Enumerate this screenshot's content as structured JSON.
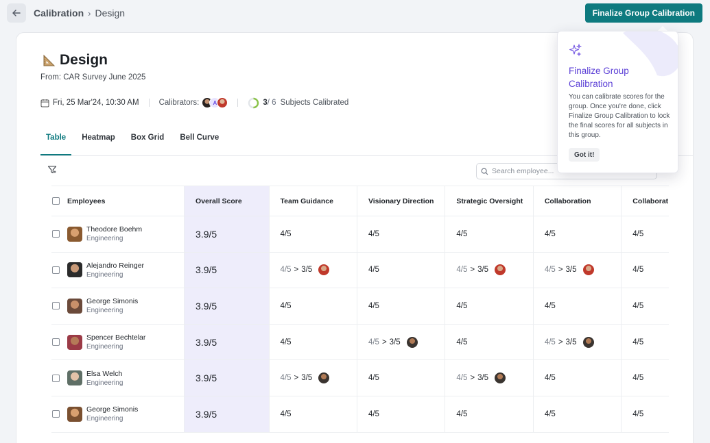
{
  "breadcrumb": {
    "root": "Calibration",
    "separator": "›",
    "current": "Design"
  },
  "header": {
    "finalize_label": "Finalize Group Calibration"
  },
  "page": {
    "title": "Design",
    "source": "From: CAR Survey June 2025",
    "date": "Fri, 25 Mar'24, 10:30 AM",
    "calibrators_label": "Calibrators:",
    "calibrator_letter": "A",
    "progress_count": "3",
    "progress_total": "/ 6",
    "progress_fraction": 0.5,
    "progress_label": "Subjects Calibrated"
  },
  "tabs": [
    {
      "label": "Table",
      "active": true
    },
    {
      "label": "Heatmap",
      "active": false
    },
    {
      "label": "Box Grid",
      "active": false
    },
    {
      "label": "Bell Curve",
      "active": false
    }
  ],
  "search": {
    "placeholder": "Search employee..."
  },
  "table": {
    "columns": [
      "Employees",
      "Overall Score",
      "Team Guidance",
      "Visionary Direction",
      "Strategic Oversight",
      "Collaboration",
      "Collaborat"
    ],
    "rows": [
      {
        "name": "Theodore Boehm",
        "dept": "Engineering",
        "overall": "3.9/5",
        "scores": [
          {
            "value": "4/5"
          },
          {
            "value": "4/5"
          },
          {
            "value": "4/5"
          },
          {
            "value": "4/5"
          },
          {
            "value": "4/5"
          }
        ]
      },
      {
        "name": "Alejandro Reinger",
        "dept": "Engineering",
        "overall": "3.9/5",
        "scores": [
          {
            "old": "4/5",
            "arrow": ">",
            "value": "3/5",
            "cal": "red"
          },
          {
            "value": "4/5"
          },
          {
            "old": "4/5",
            "arrow": ">",
            "value": "3/5",
            "cal": "red"
          },
          {
            "old": "4/5",
            "arrow": ">",
            "value": "3/5",
            "cal": "red"
          },
          {
            "value": "4/5"
          }
        ]
      },
      {
        "name": "George Simonis",
        "dept": "Engineering",
        "overall": "3.9/5",
        "scores": [
          {
            "value": "4/5"
          },
          {
            "value": "4/5"
          },
          {
            "value": "4/5"
          },
          {
            "value": "4/5"
          },
          {
            "value": "4/5"
          }
        ]
      },
      {
        "name": "Spencer Bechtelar",
        "dept": "Engineering",
        "overall": "3.9/5",
        "scores": [
          {
            "value": "4/5"
          },
          {
            "old": "4/5",
            "arrow": ">",
            "value": "3/5",
            "cal": "dark"
          },
          {
            "value": "4/5"
          },
          {
            "old": "4/5",
            "arrow": ">",
            "value": "3/5",
            "cal": "dark"
          },
          {
            "value": "4/5"
          }
        ]
      },
      {
        "name": "Elsa Welch",
        "dept": "Engineering",
        "overall": "3.9/5",
        "scores": [
          {
            "old": "4/5",
            "arrow": ">",
            "value": "3/5",
            "cal": "dark"
          },
          {
            "value": "4/5"
          },
          {
            "old": "4/5",
            "arrow": ">",
            "value": "3/5",
            "cal": "dark"
          },
          {
            "value": "4/5"
          },
          {
            "value": "4/5"
          }
        ]
      },
      {
        "name": "George Simonis",
        "dept": "Engineering",
        "overall": "3.9/5",
        "scores": [
          {
            "value": "4/5"
          },
          {
            "value": "4/5"
          },
          {
            "value": "4/5"
          },
          {
            "value": "4/5"
          },
          {
            "value": "4/5"
          }
        ]
      }
    ]
  },
  "tooltip": {
    "title": "Finalize Group Calibration",
    "body": "You can calibrate scores for the group. Once you're done, click Finalize Group Calibration to lock the final scores for all subjects in this group.",
    "button": "Got it!"
  },
  "colors": {
    "accent": "#0e7a7f",
    "tooltip_title": "#5b3fd6",
    "overall_bg": "#eeedfb"
  },
  "icons": [
    "back-arrow-icon",
    "calendar-icon",
    "filter-icon",
    "search-icon",
    "sparkle-icon",
    "ruler-triangle-icon"
  ]
}
